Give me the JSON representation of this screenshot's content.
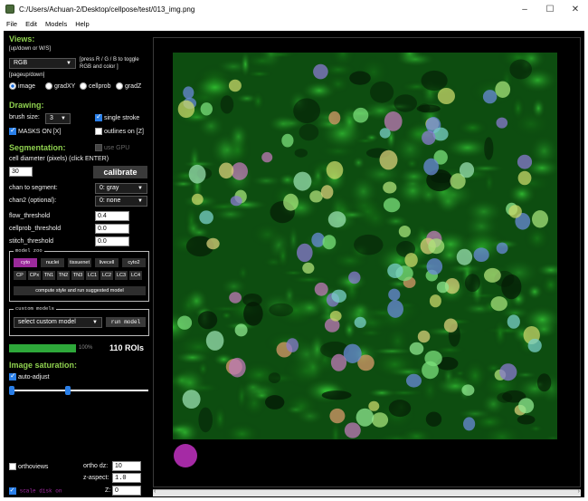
{
  "window": {
    "title": "C:/Users/Achuan-2/Desktop/cellpose/test/013_img.png",
    "minimize": "–",
    "maximize": "☐",
    "close": "✕"
  },
  "menu": [
    "File",
    "Edit",
    "Models",
    "Help"
  ],
  "views": {
    "heading": "Views:",
    "hint_updown": "[up/down or W/S]",
    "color_mode": "RGB",
    "hint_rgb": "[press R / G / B to toggle RGB and color ]",
    "hint_pageupdown": "[pageup/down]",
    "radios": [
      "image",
      "gradXY",
      "cellprob",
      "gradZ"
    ],
    "selected_radio": "image"
  },
  "drawing": {
    "heading": "Drawing:",
    "brush_label": "brush size:",
    "brush_value": "3",
    "single_stroke": "single stroke",
    "masks_on": "MASKS ON [X]",
    "outlines_on": "outlines on [Z]"
  },
  "segmentation": {
    "heading": "Segmentation:",
    "use_gpu": "use GPU",
    "diameter_label": "cell diameter (pixels) (click ENTER)",
    "diameter_value": "30",
    "calibrate": "calibrate",
    "chan_label": "chan to segment:",
    "chan_value": "0: gray",
    "chan2_label": "chan2 (optional):",
    "chan2_value": "0: none",
    "flow_label": "flow_threshold",
    "flow_value": "0.4",
    "cellprob_label": "cellprob_threshold",
    "cellprob_value": "0.0",
    "stitch_label": "stitch_threshold",
    "stitch_value": "0.0"
  },
  "model_zoo": {
    "label": "model zoo",
    "row1": [
      "cyto",
      "nuclei",
      "tissuenet",
      "livecell",
      "cyto2"
    ],
    "row2": [
      "CP",
      "CPx",
      "TN1",
      "TN2",
      "TN3",
      "LC1",
      "LC2",
      "LC3",
      "LC4"
    ],
    "selected": "cyto",
    "suggest": "compute style and run suggested model"
  },
  "custom_models": {
    "label": "custom models",
    "select": "select custom model",
    "run": "run model"
  },
  "progress": {
    "value": 100,
    "text": "100%",
    "rois": "110 ROIs"
  },
  "saturation": {
    "heading": "Image saturation:",
    "auto_adjust": "auto-adjust",
    "low": 0.0,
    "high": 0.42
  },
  "bottom": {
    "orthoviews": "orthoviews",
    "ortho_dz_label": "ortho dz:",
    "ortho_dz_value": "10",
    "z_aspect_label": "z-aspect:",
    "z_aspect_value": "1.0",
    "scale_disk": "scale disk on",
    "z_label": "Z:",
    "z_value": "0"
  },
  "colors": {
    "accent_green": "#8fd14f",
    "selected_model": "#9b2a9b",
    "progress_green": "#2ea83a",
    "scale_disk": "#a52aa5"
  }
}
